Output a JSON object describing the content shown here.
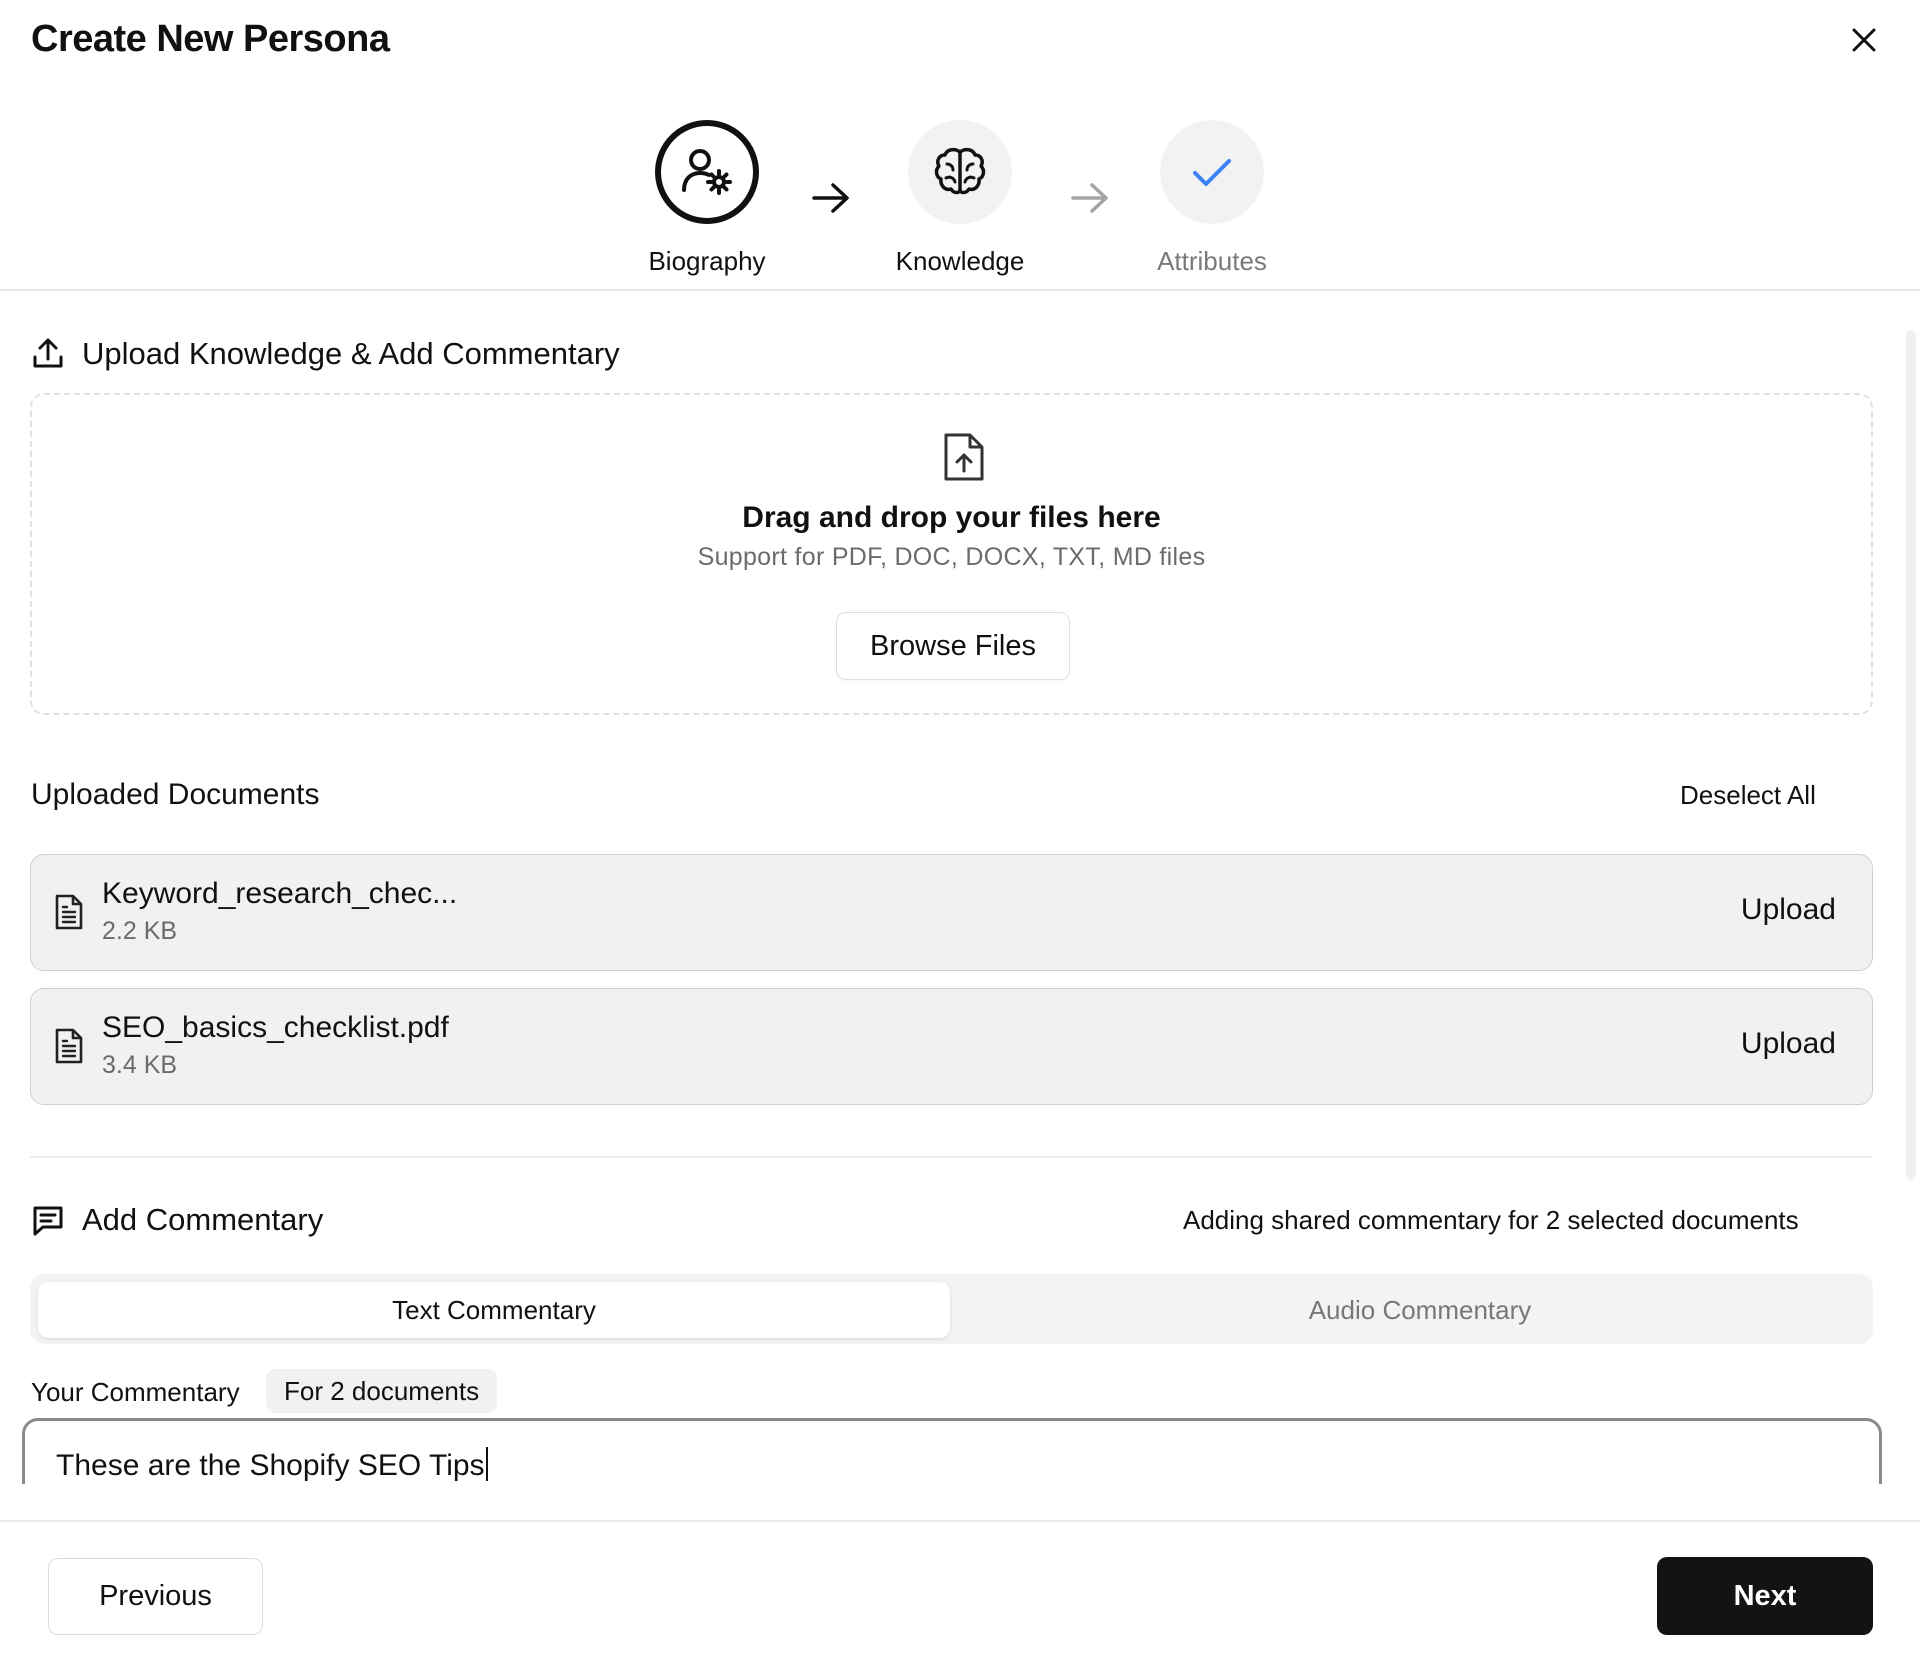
{
  "dialog": {
    "title": "Create New Persona",
    "close_icon": "close-icon"
  },
  "stepper": {
    "steps": [
      {
        "label": "Biography",
        "icon": "user-gear-icon",
        "state": "current"
      },
      {
        "label": "Knowledge",
        "icon": "brain-icon",
        "state": "upcoming"
      },
      {
        "label": "Attributes",
        "icon": "check-icon",
        "state": "upcoming"
      }
    ]
  },
  "upload_section": {
    "title": "Upload Knowledge & Add Commentary",
    "icon": "upload-icon",
    "dropzone": {
      "icon": "file-upload-icon",
      "title": "Drag and drop your files here",
      "subtitle": "Support for PDF, DOC, DOCX, TXT, MD files",
      "browse_label": "Browse Files"
    }
  },
  "documents": {
    "title": "Uploaded Documents",
    "deselect_label": "Deselect All",
    "items": [
      {
        "name": "Keyword_research_chec...",
        "size": "2.2 KB",
        "action": "Upload",
        "icon": "document-icon"
      },
      {
        "name": "SEO_basics_checklist.pdf",
        "size": "3.4 KB",
        "action": "Upload",
        "icon": "document-icon"
      }
    ]
  },
  "commentary": {
    "title": "Add Commentary",
    "icon": "comment-icon",
    "shared_note": "Adding shared commentary for 2 selected documents",
    "tabs": [
      {
        "label": "Text Commentary",
        "active": true
      },
      {
        "label": "Audio Commentary",
        "active": false
      }
    ],
    "field_label": "Your Commentary",
    "badge": "For 2 documents",
    "value": "These are the Shopify SEO Tips"
  },
  "footer": {
    "previous_label": "Previous",
    "next_label": "Next"
  },
  "colors": {
    "primary_button": "#131313",
    "checkmark_accent": "#3b82f6",
    "muted_text": "#7a7a7a",
    "document_row_bg": "#f1f1f1"
  }
}
